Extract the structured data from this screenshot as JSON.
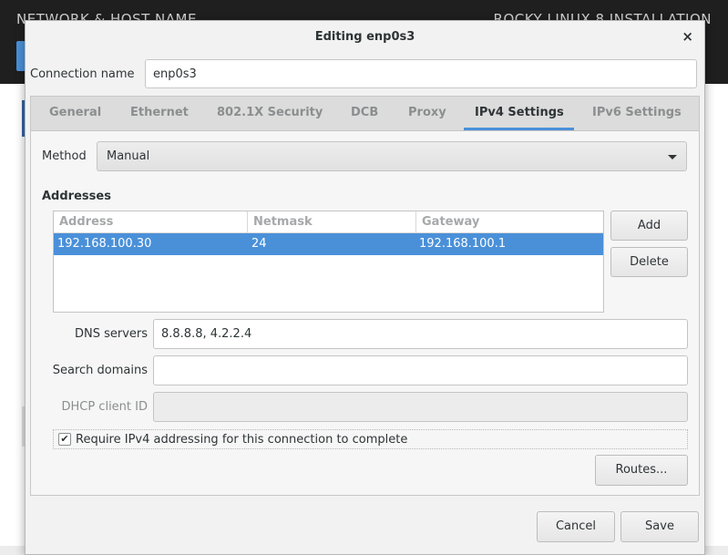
{
  "background": {
    "title": "NETWORK & HOST NAME",
    "subtitle": "ROCKY LINUX 8 INSTALLATION"
  },
  "dialog": {
    "title": "Editing enp0s3",
    "close_icon": "×",
    "connection_name_label": "Connection name",
    "connection_name_value": "enp0s3"
  },
  "tabs": [
    {
      "label": "General"
    },
    {
      "label": "Ethernet"
    },
    {
      "label": "802.1X Security"
    },
    {
      "label": "DCB"
    },
    {
      "label": "Proxy"
    },
    {
      "label": "IPv4 Settings",
      "active": true
    },
    {
      "label": "IPv6 Settings"
    }
  ],
  "ipv4": {
    "method_label": "Method",
    "method_value": "Manual",
    "addresses_title": "Addresses",
    "columns": [
      "Address",
      "Netmask",
      "Gateway"
    ],
    "rows": [
      {
        "address": "192.168.100.30",
        "netmask": "24",
        "gateway": "192.168.100.1"
      }
    ],
    "add_label": "Add",
    "delete_label": "Delete",
    "dns_label": "DNS servers",
    "dns_value": "8.8.8.8, 4.2.2.4",
    "search_label": "Search domains",
    "search_value": "",
    "dhcp_label": "DHCP client ID",
    "dhcp_value": "",
    "require_label": "Require IPv4 addressing for this connection to complete",
    "require_checked": true,
    "routes_label": "Routes..."
  },
  "footer": {
    "cancel_label": "Cancel",
    "save_label": "Save"
  },
  "colors": {
    "accent": "#4a90d9",
    "selected_row": "#4a90d9"
  }
}
